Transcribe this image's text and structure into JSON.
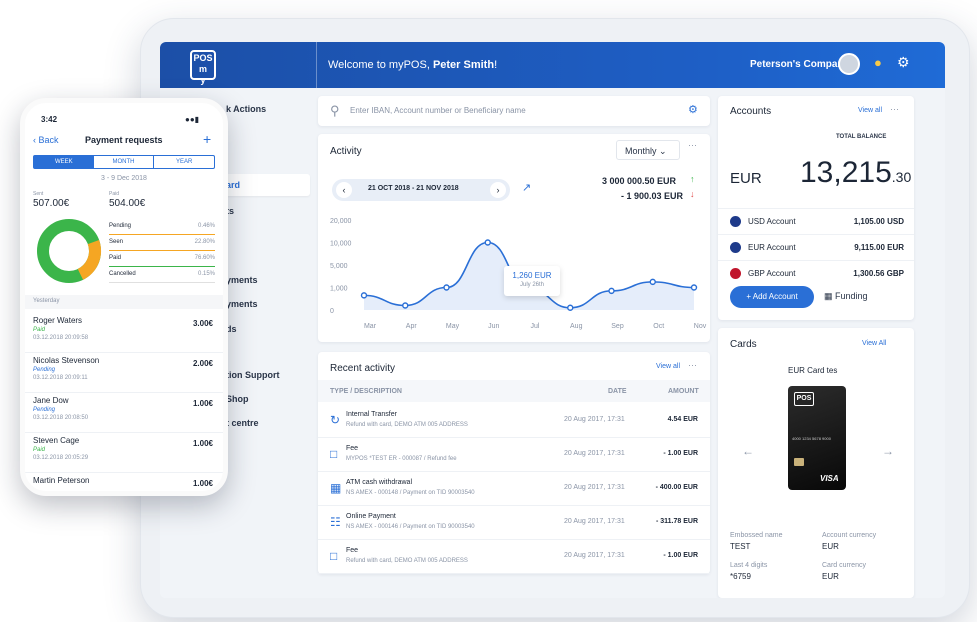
{
  "header": {
    "logo_text": "POS",
    "welcome_prefix": "Welcome to myPOS, ",
    "user_name": "Peter Smith",
    "welcome_suffix": "!",
    "company": "Peterson's Company"
  },
  "sidebar": {
    "items": [
      "k Actions",
      "ard",
      "ts",
      "yments",
      "yments",
      "ds",
      "tion Support",
      "Shop",
      "t centre"
    ]
  },
  "search": {
    "placeholder": "Enter IBAN, Account number or Beneficiary name"
  },
  "activity": {
    "title": "Activity",
    "period": "Monthly",
    "date_range": "21 OCT 2018 - 21 NOV 2018",
    "income": "3 000 000.50 EUR",
    "expense": "- 1 900.03 EUR",
    "tooltip_value": "1,260 EUR",
    "tooltip_date": "July 26th"
  },
  "chart_data": {
    "type": "area",
    "categories": [
      "Mar",
      "Apr",
      "May",
      "Jun",
      "Jul",
      "Aug",
      "Sep",
      "Oct",
      "Nov"
    ],
    "values": [
      1300,
      400,
      2000,
      6000,
      1900,
      200,
      1700,
      2500,
      2000
    ],
    "ytick_labels": [
      "20,000",
      "10,000",
      "5,000",
      "1,000",
      "0"
    ],
    "color": "#2a6fd6"
  },
  "recent": {
    "title": "Recent activity",
    "view_all": "View all",
    "col_type": "TYPE / DESCRIPTION",
    "col_date": "DATE",
    "col_amount": "AMOUNT",
    "rows": [
      {
        "title": "Internal Transfer",
        "desc": "Refund with card, DEMO ATM 005 ADDRESS",
        "date": "20 Aug 2017, 17:31",
        "amount": "4.54 EUR"
      },
      {
        "title": "Fee",
        "desc": "MYPOS *TEST ER - 000087 / Refund fee",
        "date": "20 Aug 2017, 17:31",
        "amount": "- 1.00 EUR"
      },
      {
        "title": "ATM cash withdrawal",
        "desc": "NS AMEX - 000148 / Payment on TID 90003540",
        "date": "20 Aug 2017, 17:31",
        "amount": "- 400.00 EUR"
      },
      {
        "title": "Online Payment",
        "desc": "NS AMEX - 000146 / Payment on TID 90003540",
        "date": "20 Aug 2017, 17:31",
        "amount": "- 311.78 EUR"
      },
      {
        "title": "Fee",
        "desc": "Refund with card, DEMO ATM 005 ADDRESS",
        "date": "20 Aug 2017, 17:31",
        "amount": "- 1.00 EUR"
      }
    ]
  },
  "accounts": {
    "title": "Accounts",
    "view_all": "View all",
    "total_label": "TOTAL BALANCE",
    "currency": "EUR",
    "total_int": "13,215",
    "total_dec": ".30",
    "list": [
      {
        "name": "USD Account",
        "amount": "1,105.00 USD"
      },
      {
        "name": "EUR Account",
        "amount": "9,115.00 EUR"
      },
      {
        "name": "GBP Account",
        "amount": "1,300.56 GBP"
      }
    ],
    "add_label": "+ Add Account",
    "funding_label": "Funding"
  },
  "cards": {
    "title": "Cards",
    "view_all": "View All",
    "card_name": "EUR Card tes",
    "emb_label": "Embossed name",
    "emb_value": "TEST",
    "cur_label": "Account currency",
    "cur_value": "EUR",
    "last4_label": "Last 4 digits",
    "last4_value": "*6759",
    "cc_label": "Card currency",
    "cc_value": "EUR",
    "visa": "VISA",
    "card_logo": "POS",
    "card_number": "4000 1234 5678 9000"
  },
  "phone": {
    "time": "3:42",
    "back": "Back",
    "title": "Payment requests",
    "tabs": [
      "WEEK",
      "MONTH",
      "YEAR"
    ],
    "range": "3 - 9 Dec 2018",
    "sent_label": "Sent",
    "sent_value": "507.00€",
    "paid_label": "Paid",
    "paid_value": "504.00€",
    "stats": [
      {
        "label": "Pending",
        "pct": "0.46%",
        "color": "#f5a623"
      },
      {
        "label": "Seen",
        "pct": "22.80%",
        "color": "#f5a623"
      },
      {
        "label": "Paid",
        "pct": "76.60%",
        "color": "#3bb54a"
      },
      {
        "label": "Cancelled",
        "pct": "0.15%",
        "color": "#e0e0e0"
      }
    ],
    "section": "Yesterday",
    "people": [
      {
        "name": "Roger Waters",
        "status": "Paid",
        "date": "03.12.2018 20:09:58",
        "amount": "3.00€"
      },
      {
        "name": "Nicolas Stevenson",
        "status": "Pending",
        "date": "03.12.2018 20:09:11",
        "amount": "2.00€"
      },
      {
        "name": "Jane Dow",
        "status": "Pending",
        "date": "03.12.2018 20:08:50",
        "amount": "1.00€"
      },
      {
        "name": "Steven Cage",
        "status": "Paid",
        "date": "03.12.2018 20:05:29",
        "amount": "1.00€"
      },
      {
        "name": "Martin Peterson",
        "status": "",
        "date": "",
        "amount": "1.00€"
      }
    ]
  },
  "fragment_text": "a."
}
